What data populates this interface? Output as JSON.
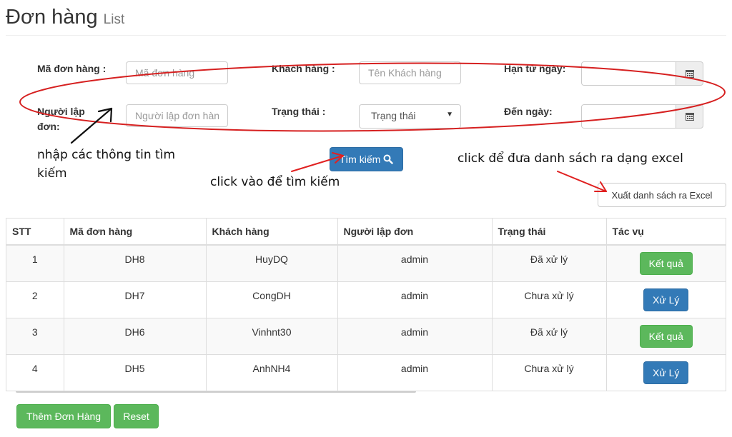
{
  "header": {
    "title": "Đơn hàng",
    "subtitle": "List"
  },
  "filters": {
    "order_code_label": "Mã đơn hàng :",
    "order_code_placeholder": "Mã đơn hàng",
    "customer_label": "Khách hàng :",
    "customer_placeholder": "Tên Khách hàng",
    "from_date_label": "Hạn từ ngày:",
    "creator_label": "Người lập đơn:",
    "creator_placeholder": "Người lập đơn hàn",
    "status_label": "Trạng thái :",
    "status_selected": "Trạng thái",
    "to_date_label": "Đến ngày:"
  },
  "search_button": "Tìm kiếm",
  "export_button": "Xuất danh sách ra Excel",
  "annotations": {
    "enter_info": "nhập các thông tin tìm kiếm",
    "click_search": "click vào để tìm kiếm",
    "click_export": "click để đưa danh sách ra dạng excel"
  },
  "table": {
    "headers": [
      "STT",
      "Mã đơn hàng",
      "Khách hàng",
      "Người lập đơn",
      "Trạng thái",
      "Tác vụ"
    ],
    "rows": [
      {
        "stt": "1",
        "code": "DH8",
        "customer": "HuyDQ",
        "creator": "admin",
        "status": "Đã xử lý",
        "action": "Kết quả"
      },
      {
        "stt": "2",
        "code": "DH7",
        "customer": "CongDH",
        "creator": "admin",
        "status": "Chưa xử lý",
        "action": "Xử Lý"
      },
      {
        "stt": "3",
        "code": "DH6",
        "customer": "Vinhnt30",
        "creator": "admin",
        "status": "Đã xử lý",
        "action": "Kết quả"
      },
      {
        "stt": "4",
        "code": "DH5",
        "customer": "AnhNH4",
        "creator": "admin",
        "status": "Chưa xử lý",
        "action": "Xử Lý"
      }
    ]
  },
  "footer": {
    "add_button": "Thêm Đơn Hàng",
    "reset_button": "Reset"
  },
  "colors": {
    "primary": "#337ab7",
    "success": "#5cb85c",
    "annotation_ellipse": "#d62020",
    "annotation_arrow": "#e02020"
  }
}
